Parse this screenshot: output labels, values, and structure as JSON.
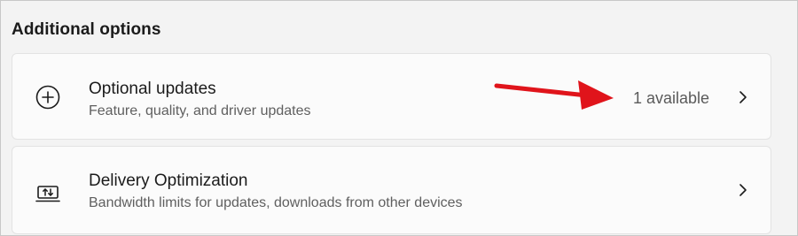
{
  "section": {
    "title": "Additional options"
  },
  "items": [
    {
      "title": "Optional updates",
      "description": "Feature, quality, and driver updates",
      "status": "1 available",
      "icon": "plus-circle-icon"
    },
    {
      "title": "Delivery Optimization",
      "description": "Bandwidth limits for updates, downloads from other devices",
      "icon": "delivery-optimization-icon"
    }
  ],
  "colors": {
    "background": "#f3f3f3",
    "card": "#fbfbfb",
    "annotation_arrow": "#e0141b"
  }
}
